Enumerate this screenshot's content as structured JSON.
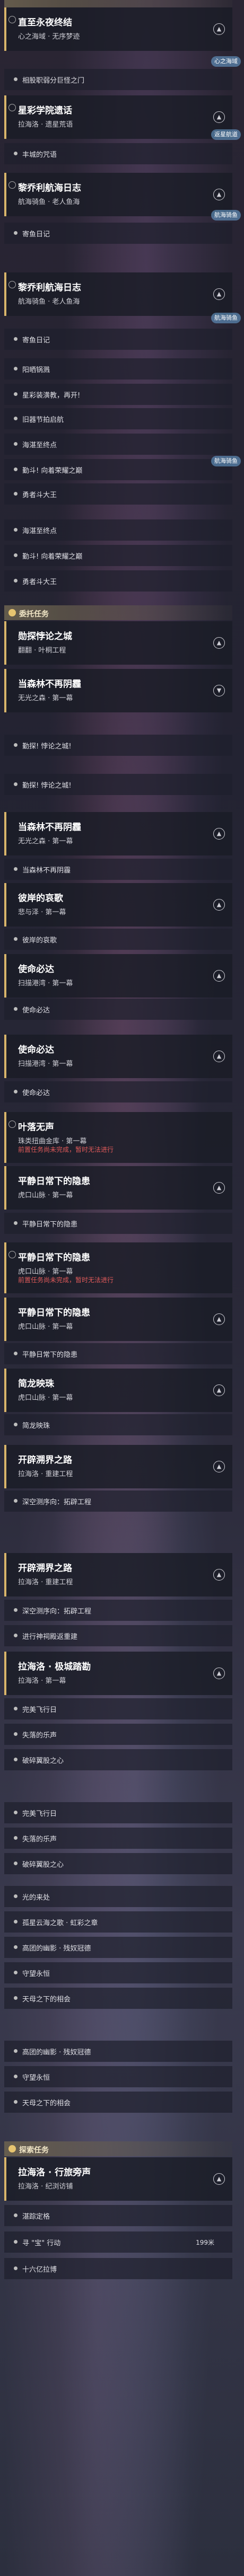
{
  "groups": {
    "top": "",
    "daily": "委托任务",
    "side": "探索任务"
  },
  "quests": [
    {
      "title": "直至永夜终结",
      "subtitle": "心之海域 · 无序梦迹"
    },
    {
      "title": "星彩学院遗话",
      "subtitle": "拉海洛 · 遗星荒语"
    },
    {
      "title": "黎乔利航海日志",
      "subtitle": "航海骑鱼 · 老人鱼海"
    },
    {
      "title": "黎乔利航海日志",
      "subtitle": "航海骑鱼 · 老人鱼海"
    },
    {
      "title": "勋探悖论之城",
      "subtitle": "翻翻 · 叶桐工程"
    },
    {
      "title": "当森林不再阴霾",
      "subtitle": "无光之森 · 第一幕"
    },
    {
      "title": "当森林不再阴霾",
      "subtitle": "无光之森 · 第一幕"
    },
    {
      "title": "彼岸的哀歌",
      "subtitle": "悲与泽 · 第一幕"
    },
    {
      "title": "使命必达",
      "subtitle": "扫描港湾 · 第一幕"
    },
    {
      "title": "使命必达",
      "subtitle": "扫描港湾 · 第一幕"
    },
    {
      "title": "叶落无声",
      "subtitle": "珠类扭曲金库 · 第一幕",
      "warn": "前置任务尚未完成，暂时无法进行"
    },
    {
      "title": "平静日常下的隐患",
      "subtitle": "虎口山脉 · 第一幕"
    },
    {
      "title": "平静日常下的隐患",
      "subtitle": "虎口山脉 · 第一幕",
      "warn": "前置任务尚未完成，暂时无法进行"
    },
    {
      "title": "平静日常下的隐患",
      "subtitle": "虎口山脉 · 第一幕"
    },
    {
      "title": "简龙映珠",
      "subtitle": "虎口山脉 · 第一幕"
    },
    {
      "title": "开辟溯界之路",
      "subtitle": "拉海洛 · 重建工程"
    },
    {
      "title": "开辟溯界之路",
      "subtitle": "拉海洛 · 重建工程"
    },
    {
      "title": "拉海洛 · 极城踏勘",
      "subtitle": "拉海洛 · 第一幕"
    },
    {
      "title": "拉海洛 · 行旅旁声",
      "subtitle": "拉海洛 · 纪浏访铺"
    }
  ],
  "subs": [
    "相股职弱分巨怪之门",
    "丰城的咒语",
    "寄鱼日记",
    "寄鱼日记",
    "阳晒锅溅",
    "星彩装潢教，再开!",
    "旧器节拍启航",
    "海湛至终点",
    "勤斗!  向着荣耀之巅",
    "勇者斗大王",
    "海湛至终点",
    "勤斗!  向着荣耀之巅",
    "勇者斗大王",
    "勤探!  悖论之城!",
    "勤探!  悖论之城!",
    "当森林不再阴霾",
    "彼岸的哀歌",
    "使命必达",
    "使命必达",
    "平静日常下的隐患",
    "平静日常下的隐患",
    "简龙映珠",
    "深空测序向：拓辟工程",
    "深空测序向：拓辟工程",
    "进行神祠殿返重建",
    "完美飞行日",
    "失落的乐声",
    "破碎翼股之心",
    "完美飞行日",
    "失落的乐声",
    "破碎翼股之心",
    "光的来处",
    "孤星云海之歌 · 虹彩之章",
    "高团的幽影 · 残奴冠德",
    "守望永恒",
    "天母之下的相会",
    "高团的幽影 · 残奴冠德",
    "守望永恒",
    "天母之下的相会",
    "湛踪定格",
    "寻 \"宝\" 行动",
    "十六亿拉博"
  ],
  "sub_count": "199米",
  "badges": {
    "heart_domain": "心之海域",
    "back": "返星航道",
    "nav": "航海骑鱼",
    "nav2": "航海骑鱼",
    "nav3": "航海骑鱼"
  }
}
